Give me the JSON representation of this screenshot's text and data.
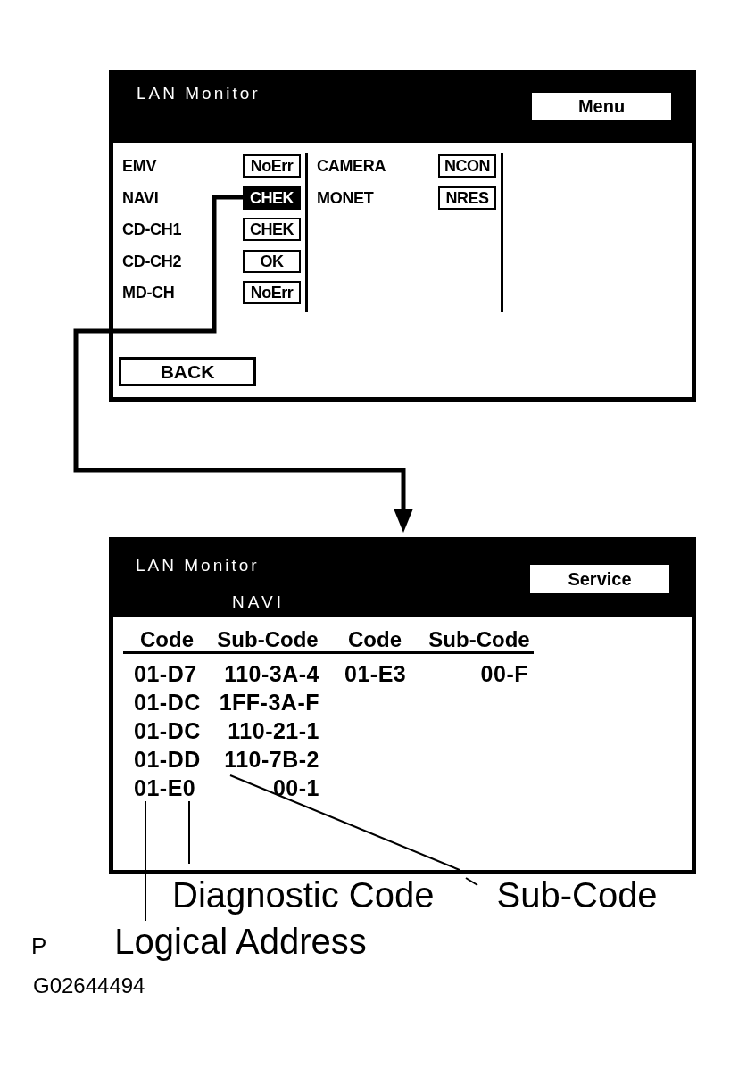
{
  "menu_screen": {
    "title": "LAN Monitor",
    "header_button": "Menu",
    "device_columns": [
      {
        "devices": [
          {
            "name": "EMV",
            "status": "NoErr",
            "selected": false
          },
          {
            "name": "NAVI",
            "status": "CHEK",
            "selected": true
          },
          {
            "name": "CD-CH1",
            "status": "CHEK",
            "selected": false
          },
          {
            "name": "CD-CH2",
            "status": "OK",
            "selected": false
          },
          {
            "name": "MD-CH",
            "status": "NoErr",
            "selected": false
          }
        ]
      },
      {
        "devices": [
          {
            "name": "CAMERA",
            "status": "NCON",
            "selected": false
          },
          {
            "name": "MONET",
            "status": "NRES",
            "selected": false
          }
        ]
      }
    ],
    "back_button": "BACK"
  },
  "detail_screen": {
    "title": "LAN Monitor",
    "device": "NAVI",
    "header_button": "Service",
    "table": {
      "columns": [
        "Code",
        "Sub-Code",
        "Code",
        "Sub-Code"
      ],
      "rows": [
        [
          "01-D7",
          "110-3A-4",
          "01-E3",
          "00-F"
        ],
        [
          "01-DC",
          "1FF-3A-F"
        ],
        [
          "01-DC",
          "110-21-1"
        ],
        [
          "01-DD",
          "110-7B-2"
        ],
        [
          "01-E0",
          "00-1"
        ]
      ]
    }
  },
  "callouts": [
    {
      "label": "Diagnostic Code"
    },
    {
      "label": "Sub-Code"
    },
    {
      "label": "Logical Address"
    }
  ],
  "figure_mark": "P",
  "figure_id": "G02644494"
}
